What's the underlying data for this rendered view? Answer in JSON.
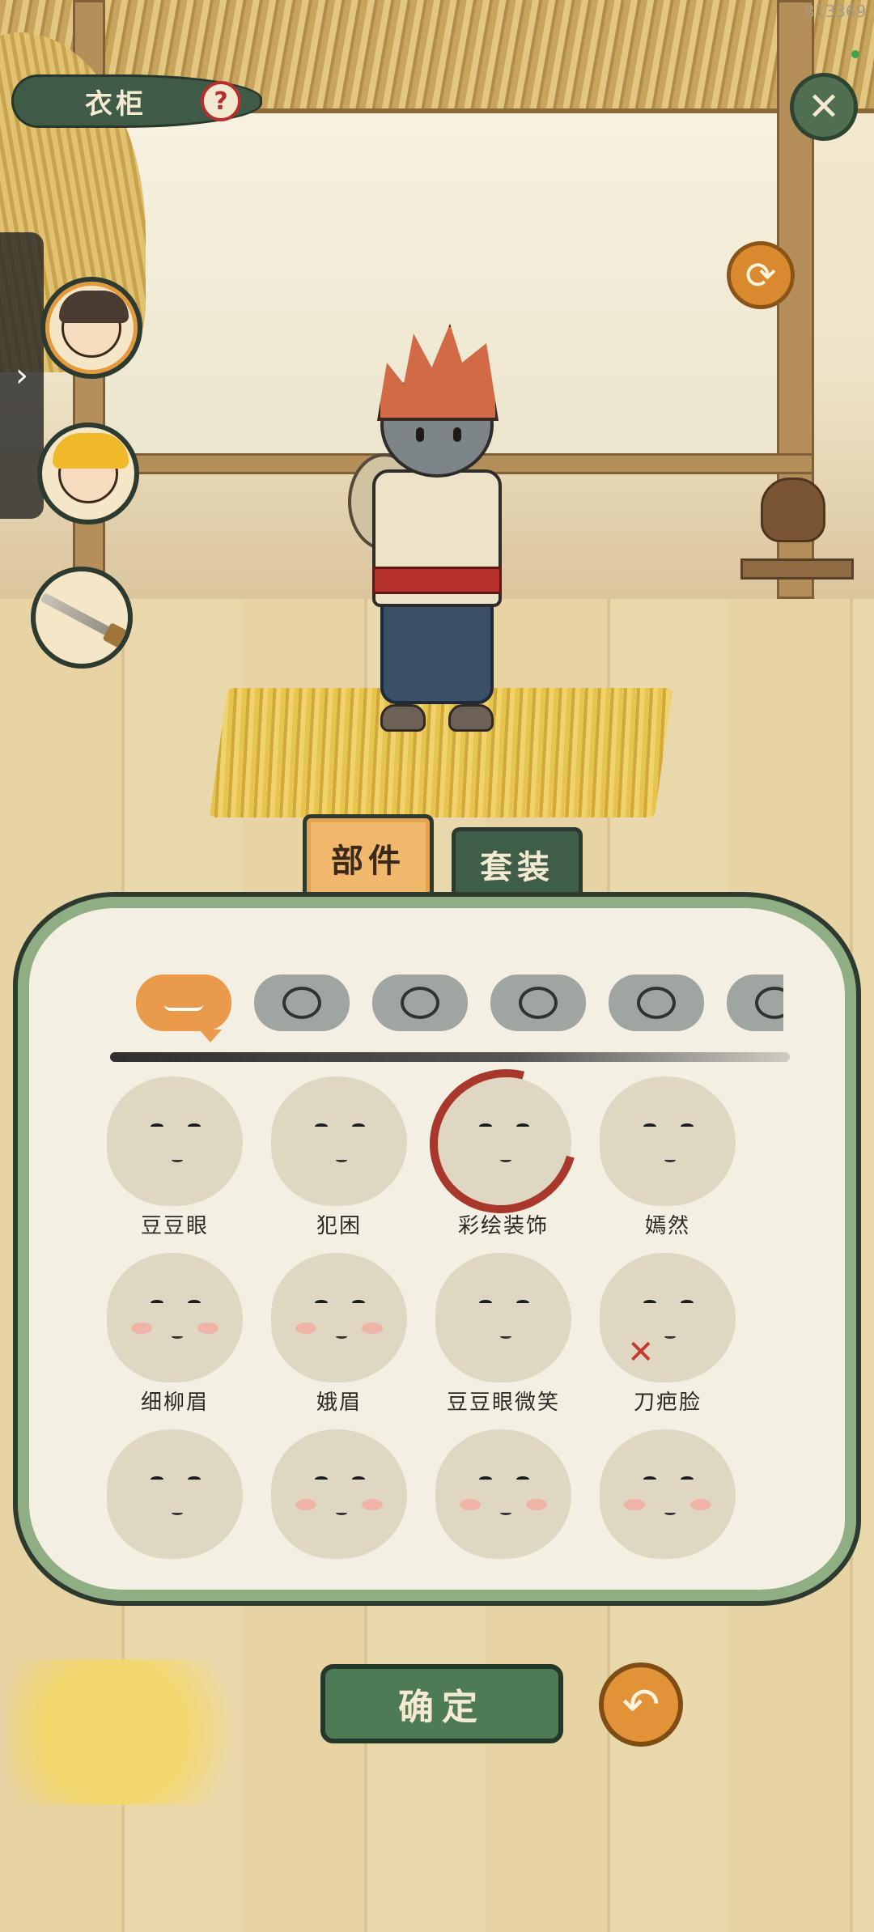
{
  "header": {
    "title": "衣柜",
    "help_icon": "?",
    "close_icon": "✕",
    "build_id": "813369",
    "refresh_icon": "⟳"
  },
  "side_tab": {
    "expand_icon": "›"
  },
  "tabs": [
    {
      "label": "部件",
      "active": true
    },
    {
      "label": "套装",
      "active": false
    }
  ],
  "categories": [
    "face",
    "hair",
    "clothing",
    "flower",
    "mountain",
    "more"
  ],
  "items": [
    {
      "label": "豆豆眼"
    },
    {
      "label": "犯困"
    },
    {
      "label": "彩绘装饰"
    },
    {
      "label": "嫣然"
    },
    {
      "label": "细柳眉"
    },
    {
      "label": "娥眉"
    },
    {
      "label": "豆豆眼微笑"
    },
    {
      "label": "刀疤脸"
    },
    {
      "label": ""
    },
    {
      "label": ""
    },
    {
      "label": ""
    },
    {
      "label": ""
    }
  ],
  "buttons": {
    "confirm_label": "确定",
    "undo_icon": "↶"
  },
  "colors": {
    "accent_orange": "#e99a4a",
    "panel_green": "#8fae84",
    "dark_green": "#3f5e4a",
    "paint_red": "#a8372c"
  }
}
